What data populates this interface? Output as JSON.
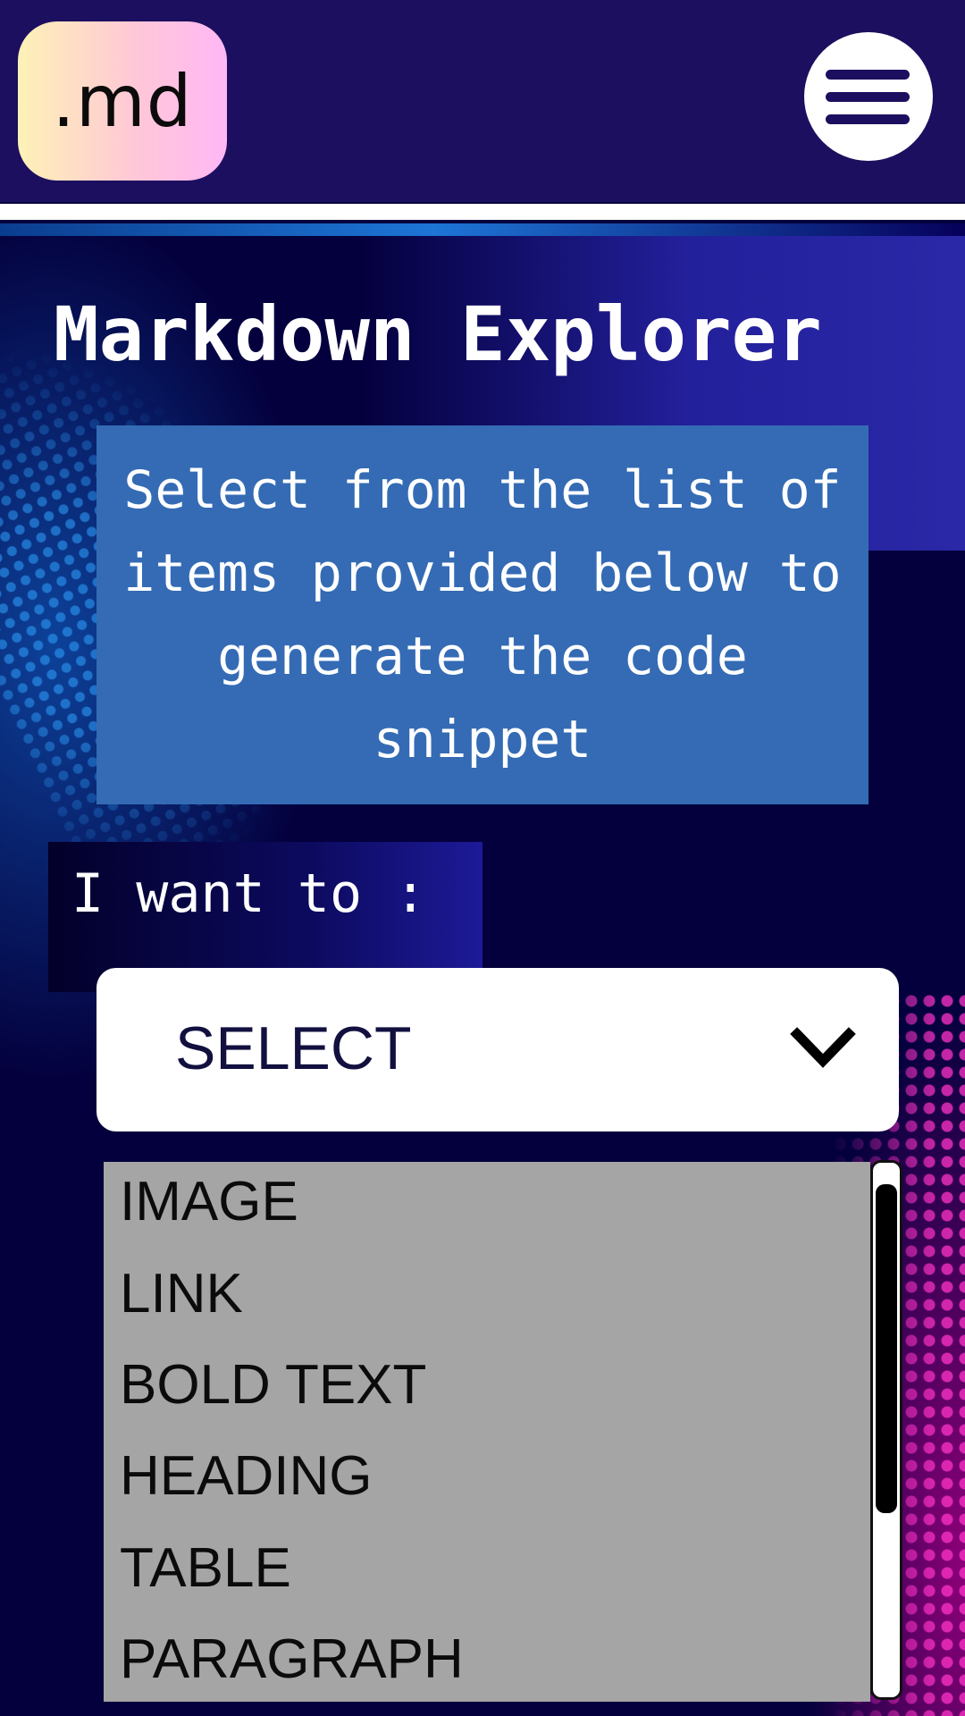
{
  "header": {
    "logo_text": ".md",
    "menu_icon": "hamburger-icon"
  },
  "main": {
    "title": "Markdown Explorer",
    "intro": "Select from the list of items provided below to generate the code snippet",
    "want_label": "I want to :",
    "select": {
      "value": "SELECT",
      "icon": "chevron-down-icon"
    },
    "options": [
      "IMAGE",
      "LINK",
      "BOLD TEXT",
      "HEADING",
      "TABLE",
      "PARAGRAPH"
    ]
  },
  "colors": {
    "header_bg": "#1c0f5f",
    "page_bg": "#04003d",
    "intro_bg": "#346bb4",
    "list_bg": "#a5a5a5"
  }
}
